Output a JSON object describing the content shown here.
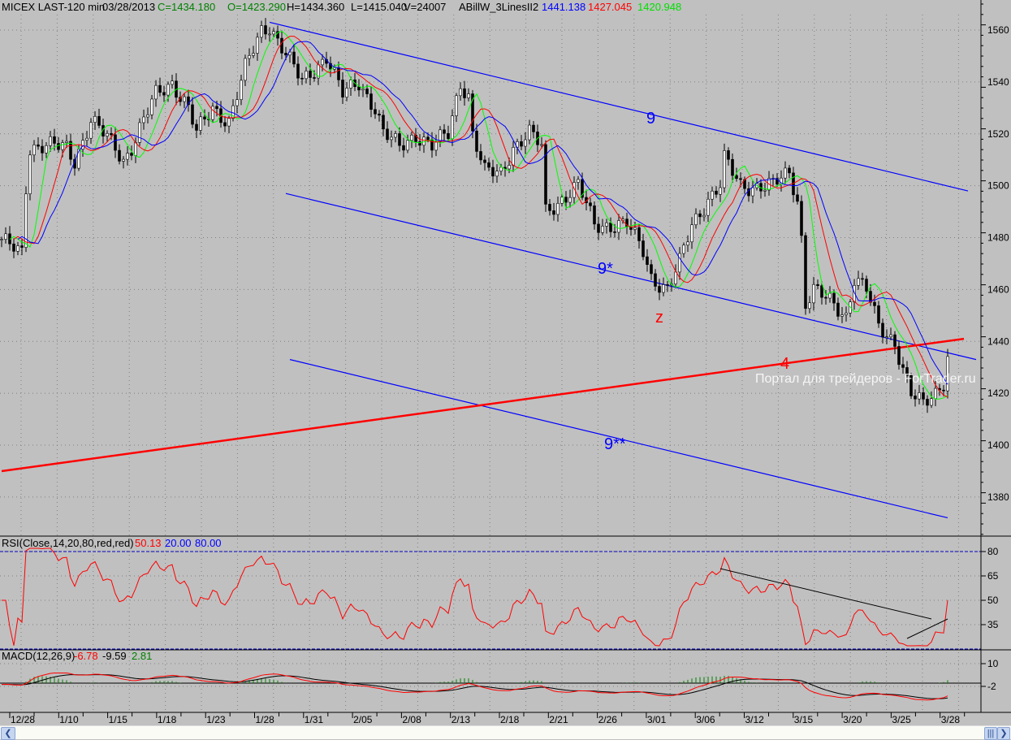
{
  "header": {
    "symbol": "MICEX LAST-120 min",
    "date": "03/28/2013",
    "close": "C=1434.180",
    "open": "O=1423.290",
    "high": "H=1434.360",
    "low": "L=1415.040",
    "volume": "V=24007",
    "indicator": "ABillW_3LinesII2",
    "ind_blue": "1441.138",
    "ind_red": "1427.045",
    "ind_green": "1420.948"
  },
  "rsi_header": {
    "label": "RSI(Close,14,20,80,red,red)",
    "value": "50.13",
    "low": "20.00",
    "high": "80.00"
  },
  "macd_header": {
    "label": "MACD(12,26,9)",
    "macd": "-6.78",
    "signal": "-9.59",
    "hist": "2.81"
  },
  "annotations": {
    "line9": "9",
    "line9s": "9*",
    "line9ss": "9**",
    "z": "z",
    "line4": "4"
  },
  "watermark": "Портал для трейдеров - ForTrader.ru",
  "colors": {
    "bg": "#c0c0c0",
    "blue": "#0000ff",
    "red": "#ff0000",
    "green": "#00ff00"
  },
  "chart_data": {
    "type": "candlestick",
    "title": "MICEX LAST-120 min",
    "price_ticks": [
      1560,
      1540,
      1520,
      1500,
      1480,
      1460,
      1440,
      1420,
      1400,
      1380
    ],
    "ylim": [
      1364,
      1570
    ],
    "x_labels": [
      "12/28",
      "1/10",
      "1/15",
      "1/18",
      "1/23",
      "1/28",
      "1/31",
      "2/05",
      "2/08",
      "2/13",
      "2/18",
      "2/21",
      "2/26",
      "3/01",
      "3/06",
      "3/12",
      "3/15",
      "3/20",
      "3/25",
      "3/28"
    ],
    "bar_count": 234,
    "close_waypoints": [
      [
        0,
        1478
      ],
      [
        5,
        1475
      ],
      [
        6,
        1500
      ],
      [
        7,
        1515
      ],
      [
        16,
        1515
      ],
      [
        18,
        1510
      ],
      [
        22,
        1525
      ],
      [
        28,
        1515
      ],
      [
        30,
        1510
      ],
      [
        32,
        1515
      ],
      [
        38,
        1535
      ],
      [
        42,
        1540
      ],
      [
        46,
        1530
      ],
      [
        48,
        1520
      ],
      [
        52,
        1530
      ],
      [
        56,
        1525
      ],
      [
        60,
        1545
      ],
      [
        64,
        1560
      ],
      [
        66,
        1562
      ],
      [
        72,
        1545
      ],
      [
        74,
        1540
      ],
      [
        80,
        1550
      ],
      [
        84,
        1535
      ],
      [
        88,
        1540
      ],
      [
        92,
        1530
      ],
      [
        94,
        1520
      ],
      [
        98,
        1515
      ],
      [
        102,
        1520
      ],
      [
        106,
        1515
      ],
      [
        110,
        1520
      ],
      [
        113,
        1540
      ],
      [
        115,
        1535
      ],
      [
        116,
        1520
      ],
      [
        119,
        1505
      ],
      [
        123,
        1505
      ],
      [
        126,
        1515
      ],
      [
        130,
        1520
      ],
      [
        133,
        1515
      ],
      [
        134,
        1490
      ],
      [
        138,
        1495
      ],
      [
        142,
        1500
      ],
      [
        146,
        1485
      ],
      [
        150,
        1485
      ],
      [
        154,
        1485
      ],
      [
        158,
        1475
      ],
      [
        160,
        1465
      ],
      [
        164,
        1460
      ],
      [
        167,
        1470
      ],
      [
        170,
        1485
      ],
      [
        174,
        1495
      ],
      [
        177,
        1500
      ],
      [
        178,
        1510
      ],
      [
        182,
        1500
      ],
      [
        186,
        1500
      ],
      [
        190,
        1500
      ],
      [
        194,
        1505
      ],
      [
        196,
        1495
      ],
      [
        197,
        1480
      ],
      [
        198,
        1455
      ],
      [
        200,
        1460
      ],
      [
        204,
        1455
      ],
      [
        208,
        1450
      ],
      [
        210,
        1465
      ],
      [
        213,
        1460
      ],
      [
        216,
        1445
      ],
      [
        220,
        1440
      ],
      [
        222,
        1430
      ],
      [
        224,
        1420
      ],
      [
        227,
        1415
      ],
      [
        230,
        1420
      ],
      [
        232,
        1425
      ],
      [
        233,
        1434
      ]
    ],
    "moving_averages": [
      {
        "name": "blue",
        "color": "#0000ff",
        "value": 1441.138
      },
      {
        "name": "red",
        "color": "#ff0000",
        "value": 1427.045
      },
      {
        "name": "green",
        "color": "#00ff00",
        "value": 1420.948
      }
    ],
    "trendlines": [
      {
        "name": "9",
        "color": "#0000ff",
        "from": [
          66,
          1563
        ],
        "to": [
          238,
          1498
        ]
      },
      {
        "name": "9*",
        "color": "#0000ff",
        "from": [
          70,
          1497
        ],
        "to": [
          240,
          1433
        ]
      },
      {
        "name": "9**",
        "color": "#0000ff",
        "from": [
          71,
          1433
        ],
        "to": [
          233,
          1372
        ]
      },
      {
        "name": "4",
        "color": "#ff0000",
        "from": [
          0,
          1390
        ],
        "to": [
          237,
          1441
        ]
      }
    ],
    "rsi": {
      "period": 14,
      "levels": [
        20,
        80
      ],
      "ticks": [
        80,
        65,
        50,
        35
      ],
      "last": 50.13,
      "trendlines": [
        {
          "from": [
            177,
            69.5
          ],
          "to": [
            229,
            38.5
          ]
        },
        {
          "from": [
            223,
            26.5
          ],
          "to": [
            233,
            38.5
          ]
        }
      ]
    },
    "macd": {
      "fast": 12,
      "slow": 26,
      "signal": 9,
      "ticks": [
        10,
        -2
      ],
      "last_macd": -6.78,
      "last_signal": -9.59,
      "last_hist": 2.81
    }
  }
}
